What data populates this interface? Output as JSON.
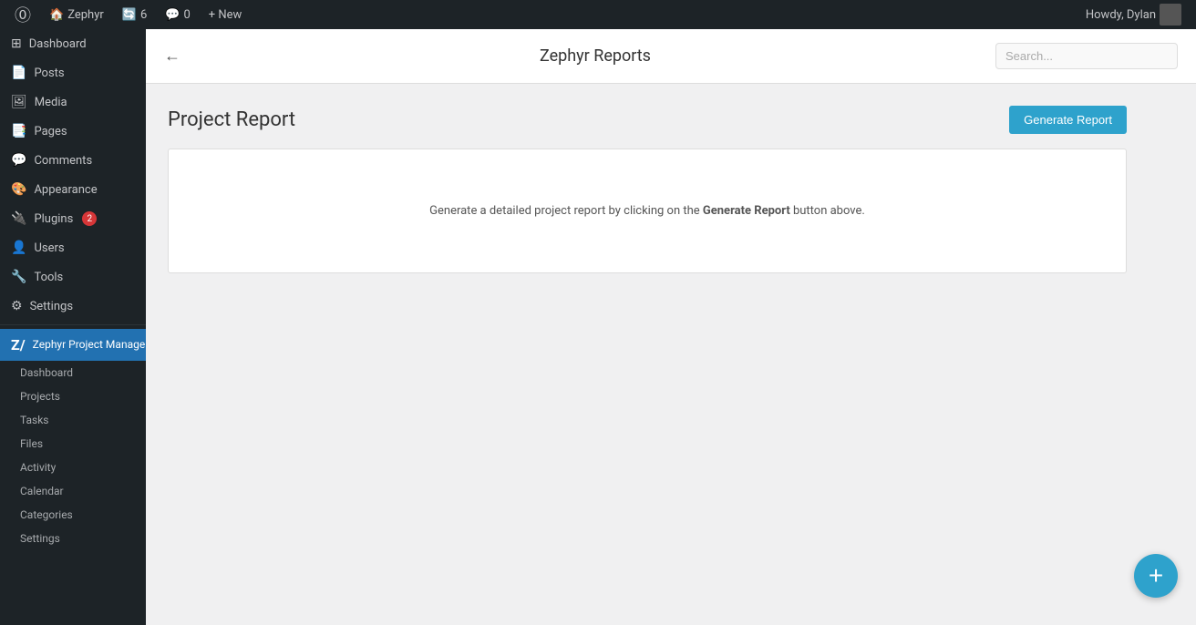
{
  "adminbar": {
    "site_name": "Zephyr",
    "updates_count": "6",
    "comments_count": "0",
    "new_label": "+ New",
    "howdy": "Howdy, Dylan"
  },
  "sidebar": {
    "menu_items": [
      {
        "id": "dashboard",
        "label": "Dashboard",
        "icon": "⊞"
      },
      {
        "id": "posts",
        "label": "Posts",
        "icon": "📄"
      },
      {
        "id": "media",
        "label": "Media",
        "icon": "🖼"
      },
      {
        "id": "pages",
        "label": "Pages",
        "icon": "📑"
      },
      {
        "id": "comments",
        "label": "Comments",
        "icon": "💬"
      },
      {
        "id": "appearance",
        "label": "Appearance",
        "icon": "🎨"
      },
      {
        "id": "plugins",
        "label": "Plugins",
        "icon": "🔌",
        "badge": "2"
      },
      {
        "id": "users",
        "label": "Users",
        "icon": "👤"
      },
      {
        "id": "tools",
        "label": "Tools",
        "icon": "🔧"
      },
      {
        "id": "settings",
        "label": "Settings",
        "icon": "⚙"
      }
    ],
    "active_plugin": "Zephyr Project Manager",
    "submenu": [
      {
        "id": "sub-dashboard",
        "label": "Dashboard"
      },
      {
        "id": "sub-projects",
        "label": "Projects"
      },
      {
        "id": "sub-tasks",
        "label": "Tasks"
      },
      {
        "id": "sub-files",
        "label": "Files"
      },
      {
        "id": "sub-activity",
        "label": "Activity"
      },
      {
        "id": "sub-calendar",
        "label": "Calendar"
      },
      {
        "id": "sub-categories",
        "label": "Categories"
      },
      {
        "id": "sub-settings",
        "label": "Settings"
      }
    ]
  },
  "page": {
    "title": "Zephyr Reports",
    "search_placeholder": "Search...",
    "back_label": "←",
    "section_title": "Project Report",
    "generate_btn_label": "Generate Report",
    "report_message_prefix": "Generate a detailed project report by clicking on the ",
    "report_message_bold": "Generate Report",
    "report_message_suffix": " button above.",
    "fab_label": "+"
  }
}
